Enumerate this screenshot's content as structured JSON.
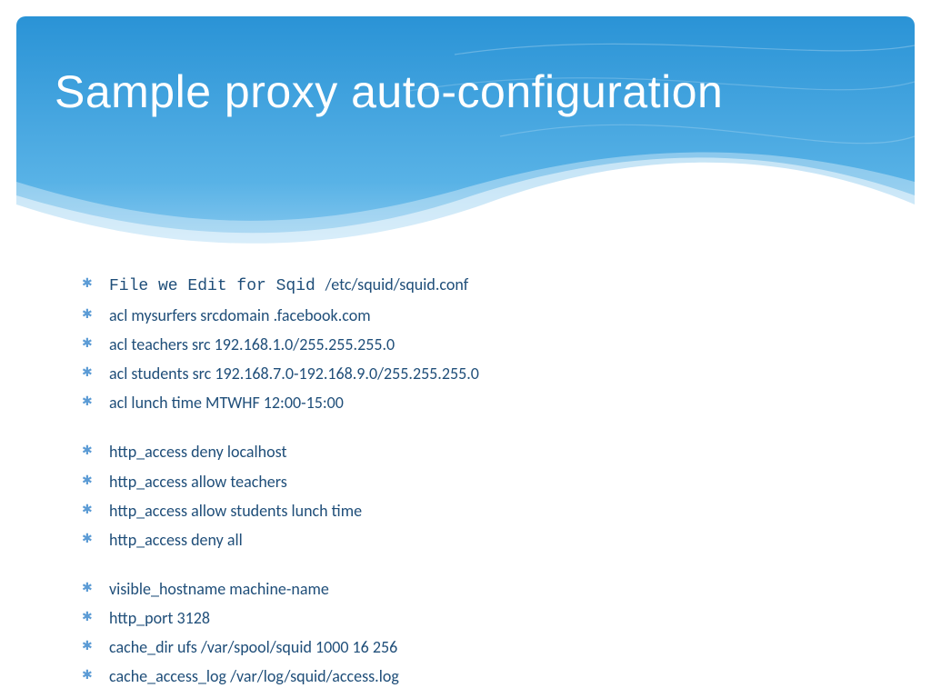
{
  "slide": {
    "title": "Sample proxy auto-configuration"
  },
  "lines": {
    "l0_mono": "File we Edit for Sqid ",
    "l0_rest": "/etc/squid/squid.conf",
    "l1": "acl mysurfers srcdomain .facebook.com",
    "l2": " acl teachers src 192.168.1.0/255.255.255.0",
    "l3": " acl students src 192.168.7.0-192.168.9.0/255.255.255.0",
    "l4": "acl lunch time MTWHF 12:00-15:00",
    "l5": "http_access deny localhost",
    "l6": "http_access allow teachers",
    "l7": "http_access allow students lunch time",
    "l8": "http_access deny all",
    "l9": "visible_hostname machine-name",
    "l10": "http_port 3128",
    "l11": "cache_dir ufs /var/spool/squid 1000 16 256",
    "l12": " cache_access_log /var/log/squid/access.log"
  },
  "colors": {
    "title_text": "#ffffff",
    "body_text": "#1f4e79",
    "bullet": "#5b9bd5",
    "wave_dark": "#1e8bd1",
    "wave_mid": "#4ba8e0",
    "wave_light": "#a7d6f2"
  }
}
